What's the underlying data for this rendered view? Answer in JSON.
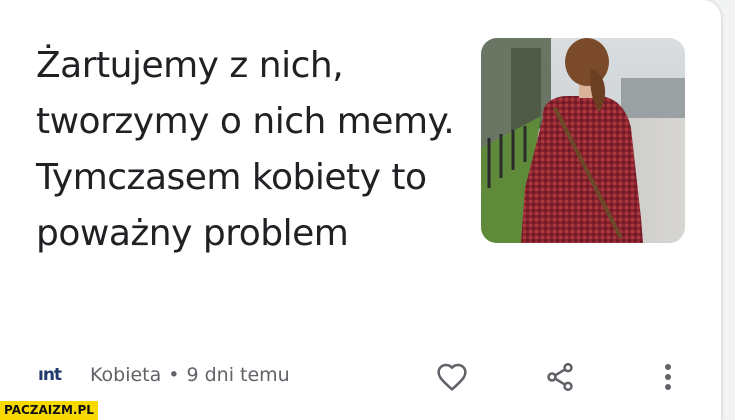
{
  "card": {
    "headline": "Żartujemy z nich, tworzymy o nich memy. Tymczasem kobiety to poważny problem",
    "source": {
      "logo_text": "ınt",
      "name": "Kobieta",
      "separator": "•",
      "time_ago": "9 dni temu"
    },
    "thumbnail": {
      "icon": "photo-woman-red-sweater"
    },
    "actions": {
      "like_icon": "heart-outline-icon",
      "share_icon": "share-icon",
      "more_icon": "more-vert-icon"
    }
  },
  "watermark": {
    "text": "PACZAIZM.PL"
  },
  "colors": {
    "headline": "#202124",
    "meta": "#5f6368",
    "icons": "#5f6368",
    "watermark_bg": "#f7d900"
  }
}
